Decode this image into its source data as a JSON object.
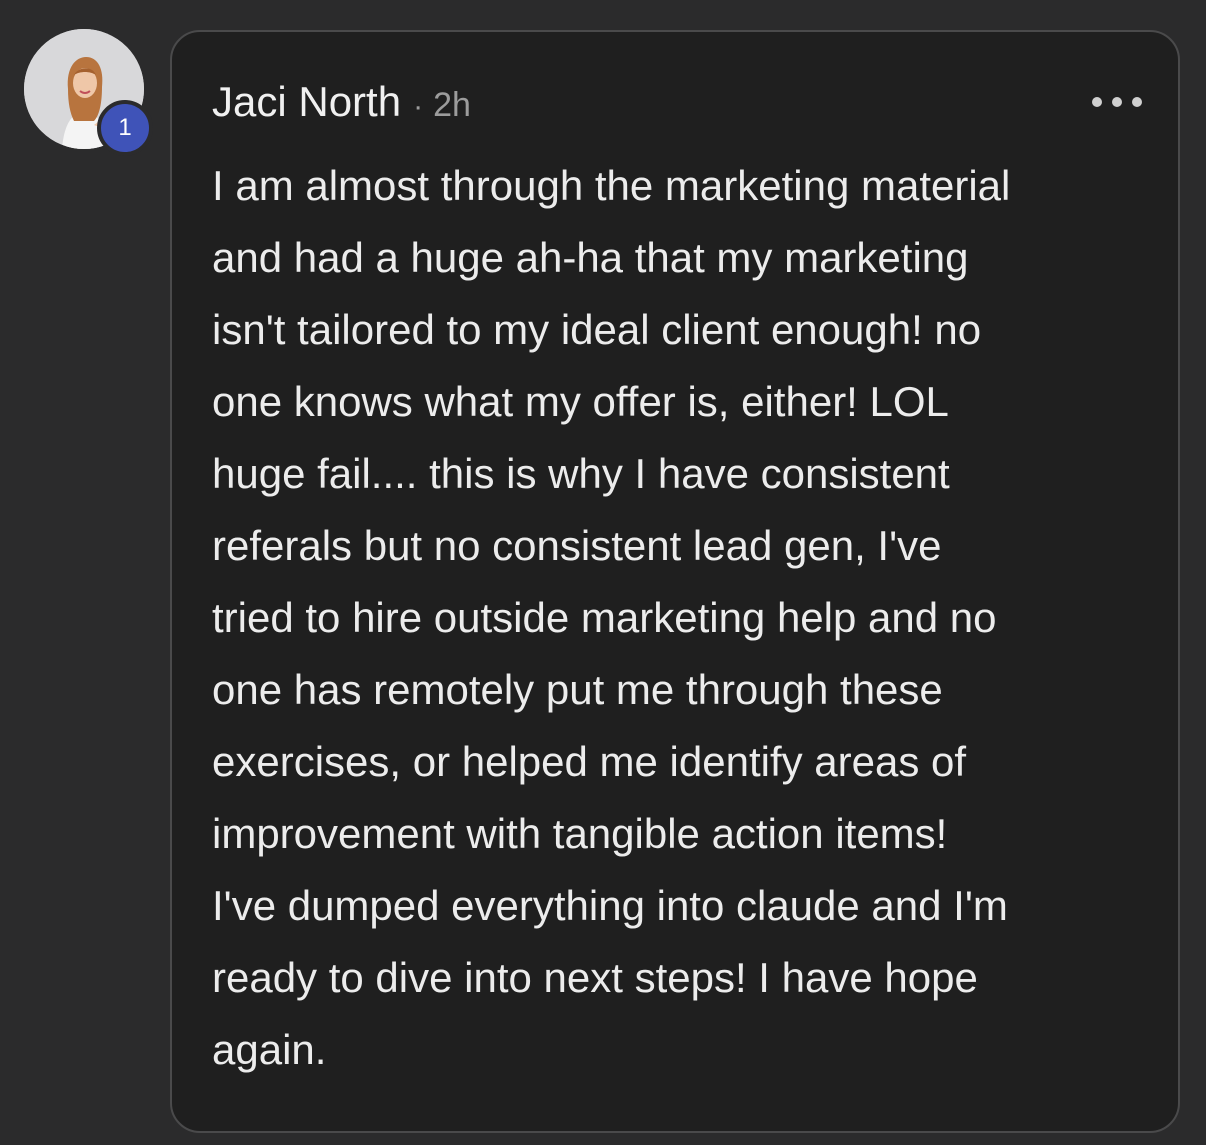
{
  "comment": {
    "author": "Jaci North",
    "separator": "·",
    "timestamp": "2h",
    "level_badge": "1",
    "body": "I am almost through the marketing material\nand had a huge ah-ha that my marketing\nisn't tailored to my ideal client enough! no\none knows what my offer is, either! LOL\nhuge fail.... this is why I have consistent\nreferals but no consistent lead gen, I've\ntried to hire outside marketing help and no\none has remotely put me through these\nexercises, or helped me identify areas of\nimprovement with tangible action items!\nI've dumped everything into claude and I'm\nready to dive into next steps! I have hope\nagain.",
    "more_icon": "more-horizontal-icon"
  },
  "colors": {
    "page_background": "#2b2b2c",
    "card_background": "#1f1f1f",
    "card_border": "#4a4a4b",
    "badge": "#3f53b8",
    "text_primary": "#ececec",
    "text_secondary": "#9c9c9c"
  }
}
